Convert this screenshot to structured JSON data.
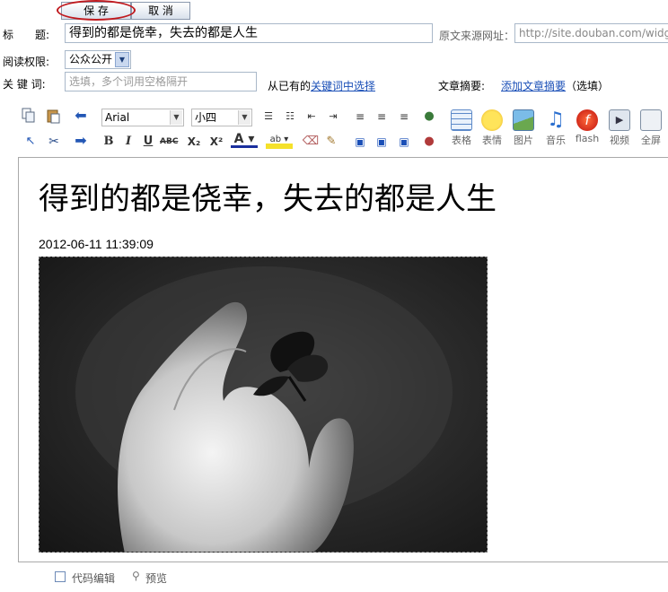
{
  "toolbar_top": {
    "save_label": "保 存",
    "cancel_label": "取 消"
  },
  "form": {
    "title_label": "标　　题:",
    "title_value": "得到的都是侥幸，失去的都是人生",
    "source_label": "原文来源网址：",
    "source_placeholder": "http://site.douban.com/widget/n",
    "permission_label": "阅读权限:",
    "permission_value": "公众公开",
    "keywords_label": "关 键 词:",
    "keywords_placeholder": "选填，多个词用空格隔开",
    "keywords_choose_prefix": "从已有的",
    "keywords_choose_link": "关键词中选择",
    "summary_label": "文章摘要:",
    "summary_link": "添加文章摘要",
    "summary_optional": "（选填）"
  },
  "editor_toolbar": {
    "font_family": "Arial",
    "font_size": "小四",
    "big_tools": [
      "表格",
      "表情",
      "图片",
      "音乐",
      "flash",
      "视频",
      "全屏"
    ]
  },
  "document": {
    "title": "得到的都是侥幸，失去的都是人生",
    "date": "2012-06-11 11:39:09"
  },
  "footer": {
    "code_edit_label": "代码编辑",
    "preview_label": "预览"
  }
}
